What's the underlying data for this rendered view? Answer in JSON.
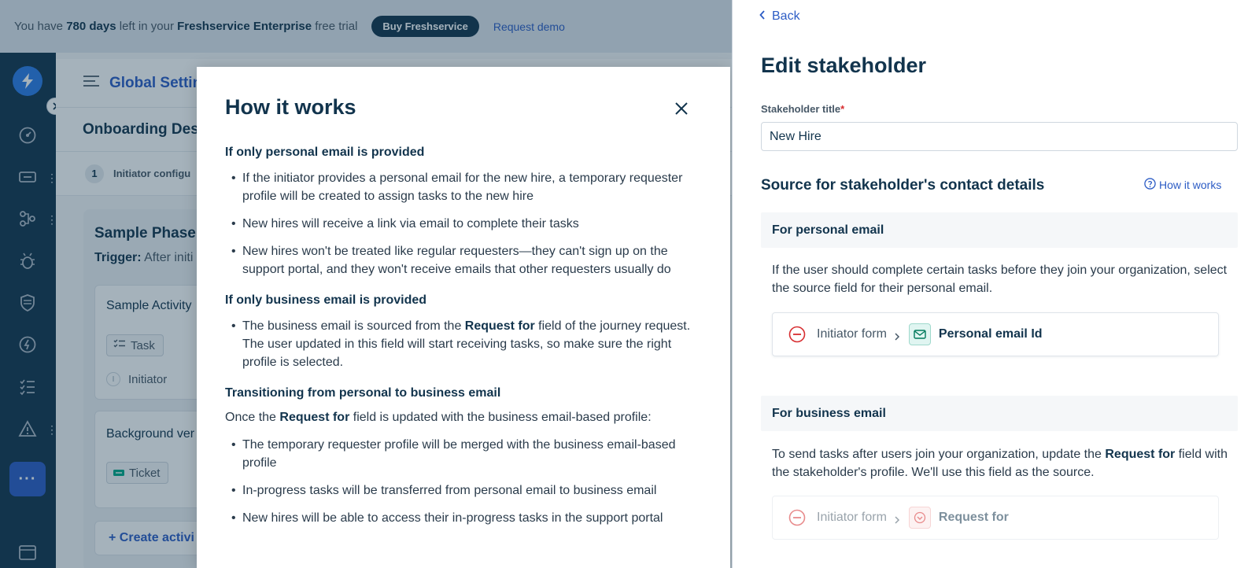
{
  "banner": {
    "text_prefix": "You have",
    "days": "780 days",
    "text_mid": "left in your",
    "plan": "Freshservice Enterprise",
    "text_suffix": "free trial",
    "buy_button": "Buy Freshservice",
    "request_demo": "Request demo"
  },
  "app": {
    "header_title": "Global Settin",
    "subheader_title": "Onboarding Desi",
    "step_number": "1",
    "step_label": "Initiator configu",
    "phase": {
      "title": "Sample Phase",
      "trigger_label": "Trigger:",
      "trigger_value": "After initi"
    },
    "activities": [
      {
        "title": "Sample Activity",
        "tag": "Task",
        "assignee_initial": "I",
        "assignee": "Initiator"
      },
      {
        "title": "Background ver",
        "tag": "Ticket"
      }
    ],
    "create_activity": "+ Create activi"
  },
  "modal": {
    "title": "How it works",
    "sections": [
      {
        "heading": "If only personal email is provided",
        "bullets": [
          "If the initiator provides a personal email for the new hire, a temporary requester profile will be created to assign tasks to the new hire",
          "New hires will receive a link via email to complete their tasks",
          "New hires won't be treated like regular requesters—they can't sign up on the support portal, and they won't receive emails that other requesters usually do"
        ]
      },
      {
        "heading": "If only business email is provided",
        "bullet_pre": "The business email is sourced from the",
        "bullet_bold": "Request for",
        "bullet_post": "field of the journey request. The user updated in this field will start receiving tasks, so make sure the right profile is selected."
      },
      {
        "heading": "Transitioning from personal to business email",
        "intro_pre": "Once the",
        "intro_bold": "Request for",
        "intro_post": "field is updated with the business email-based profile:",
        "bullets": [
          "The temporary requester profile will be merged with the business email-based profile",
          "In-progress tasks will be transferred from personal email to business email",
          "New hires will be able to access their in-progress tasks in the support portal"
        ]
      }
    ]
  },
  "drawer": {
    "back": "Back",
    "title": "Edit stakeholder",
    "field_label": "Stakeholder title",
    "required_mark": "*",
    "field_value": "New Hire",
    "section_title": "Source for stakeholder's contact details",
    "how_link": "How it works",
    "personal": {
      "heading": "For personal email",
      "description": "If the user should complete certain tasks before they join your organization, select the source field for their personal email.",
      "source_form": "Initiator form",
      "source_field": "Personal email Id"
    },
    "business": {
      "heading": "For business email",
      "description_pre": "To send tasks after users join your organization, update the",
      "description_bold": "Request for",
      "description_post": "field with the stakeholder's profile. We'll use this field as the source.",
      "source_form": "Initiator form",
      "source_field": "Request for"
    }
  },
  "colors": {
    "brand_blue": "#2c5cc5",
    "nav_dark": "#12344d",
    "remove_red": "#d72d30",
    "chip_green": "#00795b"
  }
}
